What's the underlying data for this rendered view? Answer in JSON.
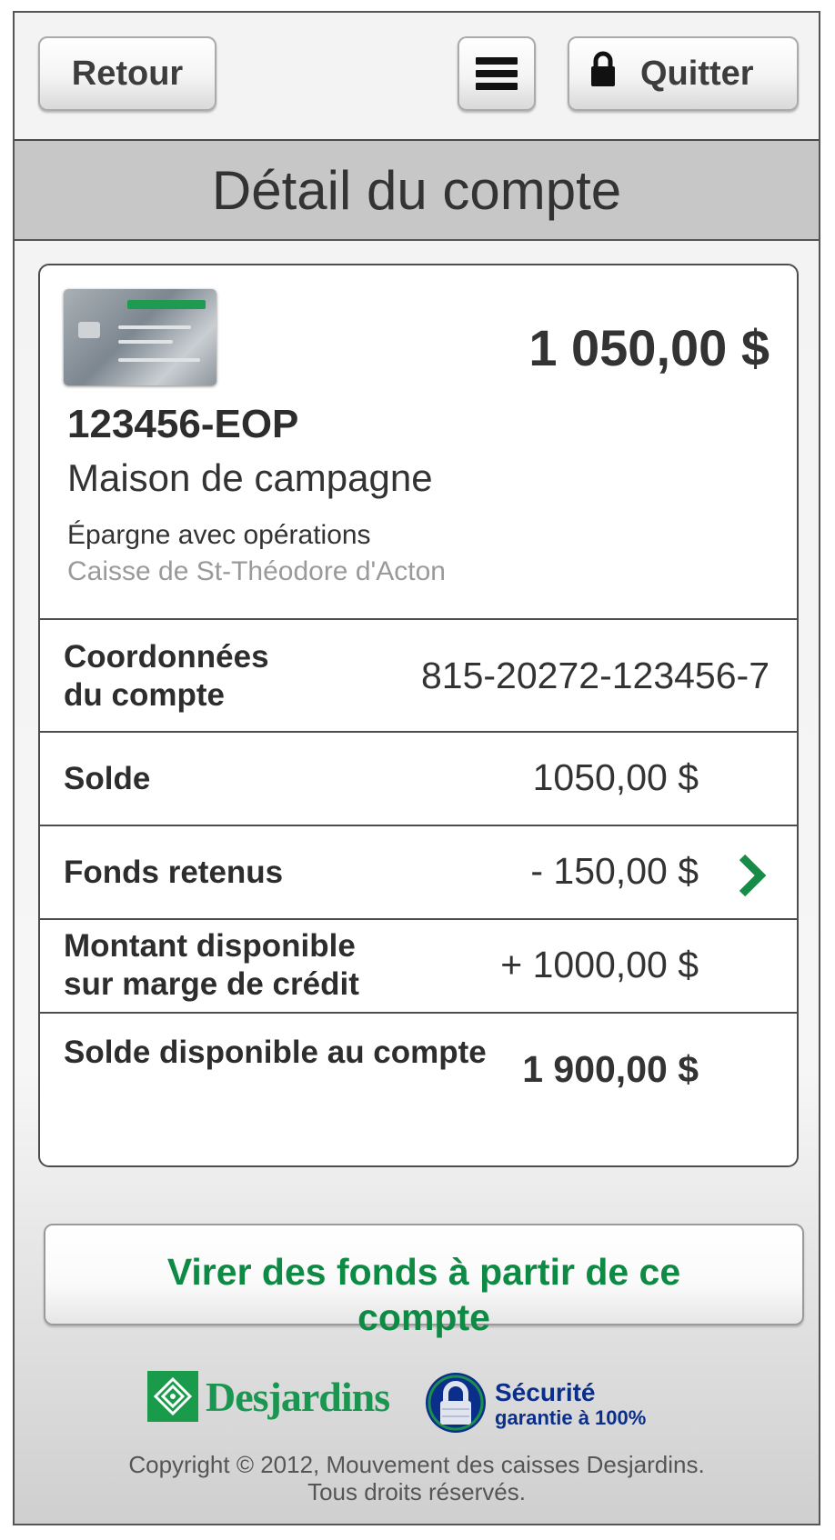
{
  "header": {
    "back_label": "Retour",
    "quit_label": "Quitter"
  },
  "page": {
    "title": "Détail du compte"
  },
  "account": {
    "balance_display": "1 050,00 $",
    "id": "123456-EOP",
    "name": "Maison de campagne",
    "type": "Épargne avec opérations",
    "caisse": "Caisse de St-Théodore d'Acton"
  },
  "details": {
    "coordonnees_label_1": "Coordonnées",
    "coordonnees_label_2": "du compte",
    "coordonnees_value": "815-20272-123456-7",
    "solde_label": "Solde",
    "solde_value": "1050,00 $",
    "fonds_label": "Fonds retenus",
    "fonds_value": "- 150,00 $",
    "marge_label_1": "Montant disponible",
    "marge_label_2": "sur marge de crédit",
    "marge_value": "+ 1000,00 $",
    "dispo_label": "Solde disponible au compte",
    "dispo_value": "1 900,00 $"
  },
  "action": {
    "transfer_label": "Virer des fonds à partir de ce compte"
  },
  "footer": {
    "brand": "Desjardins",
    "security_line1": "Sécurité",
    "security_line2": "garantie à 100%",
    "copyright_line1": "Copyright © 2012, Mouvement des caisses Desjardins.",
    "copyright_line2": "Tous droits réservés."
  },
  "colors": {
    "accent_green": "#0f8a45",
    "security_blue": "#0a2f8a",
    "title_bar": "#c7c7c7"
  },
  "icons": [
    "menu-icon",
    "lock-icon",
    "chevron-right-icon",
    "desjardins-logo-icon",
    "security-lock-icon"
  ]
}
